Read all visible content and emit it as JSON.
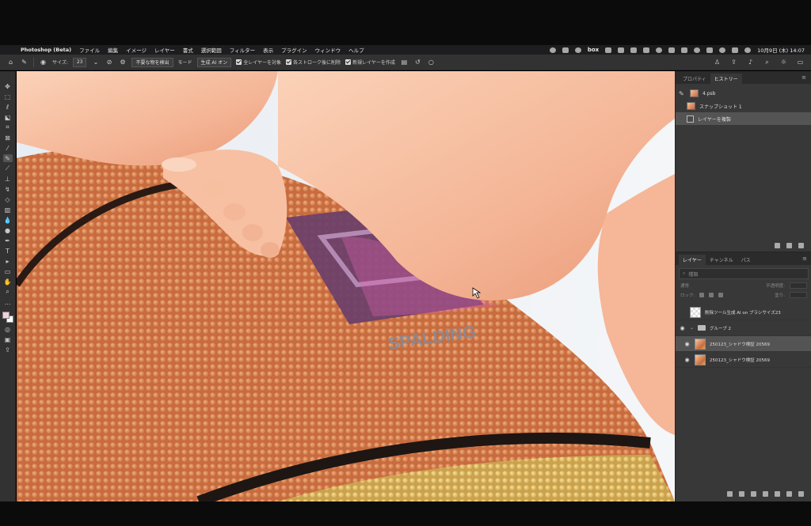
{
  "menubar": {
    "app_name": "Photoshop (Beta)",
    "items": [
      "ファイル",
      "編集",
      "イメージ",
      "レイヤー",
      "書式",
      "選択範囲",
      "フィルター",
      "表示",
      "プラグイン",
      "ウィンドウ",
      "ヘルプ"
    ],
    "box_label": "box",
    "datetime": "10月9日 (木)  14:07"
  },
  "options": {
    "size_label": "サイズ:",
    "size_value": "23",
    "remove_objects_label": "不要な物を検出",
    "mode_label": "モード",
    "mode_value": "生成 AI オン",
    "sample_all_layers": "全レイヤーを対象",
    "remove_after_stroke": "各ストローク後に削除",
    "new_layer": "新規レイヤーを作成"
  },
  "history_panel": {
    "tabs": [
      "プロパティ",
      "ヒストリー"
    ],
    "active_tab": "ヒストリー",
    "snapshot_name": "4.psb",
    "entries": [
      "スナップショット 1",
      "レイヤーを複製"
    ]
  },
  "layers_panel": {
    "tabs": [
      "レイヤー",
      "チャンネル",
      "パス"
    ],
    "active_tab": "レイヤー",
    "search_kind": "種類",
    "blend_mode": "通常",
    "opacity_label": "不透明度:",
    "lock_label": "ロック:",
    "fill_label": "塗り:",
    "layers": [
      {
        "name": "削除ツール生成 AI on ブラシサイズ23",
        "type": "empty"
      },
      {
        "name": "グループ 2",
        "type": "group"
      },
      {
        "name": "250123_シャドウ検証 20569",
        "type": "photo",
        "selected": true
      },
      {
        "name": "250123_シャドウ検証 20569",
        "type": "photo"
      }
    ]
  },
  "canvas": {
    "ball_text": "SPALDING"
  }
}
